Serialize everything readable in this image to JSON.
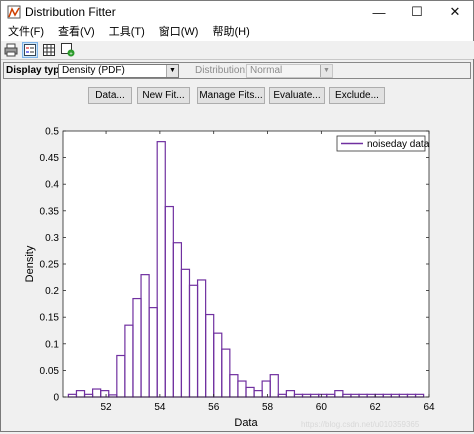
{
  "window": {
    "title": "Distribution Fitter",
    "min_icon": "minimize-icon",
    "max_icon": "maximize-icon",
    "close_icon": "close-icon"
  },
  "menu": [
    "文件(F)",
    "查看(V)",
    "工具(T)",
    "窗口(W)",
    "帮助(H)"
  ],
  "toolbar": {
    "icons": [
      "print-icon",
      "legend-icon",
      "grid-icon",
      "confidence-bounds-icon"
    ]
  },
  "options": {
    "display_type_label": "Display type:",
    "display_type_value": "Density (PDF)",
    "distribution_label": "Distribution:",
    "distribution_value": "Normal"
  },
  "buttons": {
    "data": "Data...",
    "new_fit": "New Fit...",
    "manage_fits": "Manage Fits...",
    "evaluate": "Evaluate...",
    "exclude": "Exclude..."
  },
  "watermark": "https://blog.csdn.net/u010359365",
  "chart_data": {
    "type": "bar",
    "xlabel": "Data",
    "ylabel": "Density",
    "xlim": [
      50.4,
      64.0
    ],
    "ylim": [
      0,
      0.5
    ],
    "xticks": [
      52,
      54,
      56,
      58,
      60,
      62,
      64
    ],
    "yticks": [
      0,
      0.05,
      0.1,
      0.15,
      0.2,
      0.25,
      0.3,
      0.35,
      0.4,
      0.45,
      0.5
    ],
    "bin_edges": [
      50.6,
      50.9,
      51.2,
      51.5,
      51.8,
      52.1,
      52.4,
      52.7,
      53.0,
      53.3,
      53.6,
      53.9,
      54.2,
      54.5,
      54.8,
      55.1,
      55.4,
      55.7,
      56.0,
      56.3,
      56.6,
      56.9,
      57.2,
      57.5,
      57.8,
      58.1,
      58.4,
      58.7,
      59.0,
      59.3,
      59.6,
      59.9,
      60.2,
      60.5,
      60.8,
      61.1,
      61.4,
      61.7,
      62.0,
      62.3,
      62.6,
      62.9,
      63.2,
      63.5,
      63.8
    ],
    "series": [
      {
        "name": "noiseday data",
        "values": [
          0.005,
          0.012,
          0.005,
          0.015,
          0.012,
          0.004,
          0.078,
          0.135,
          0.185,
          0.23,
          0.168,
          0.48,
          0.358,
          0.29,
          0.24,
          0.21,
          0.22,
          0.155,
          0.12,
          0.09,
          0.042,
          0.03,
          0.018,
          0.012,
          0.03,
          0.042,
          0.005,
          0.012,
          0.005,
          0.005,
          0.005,
          0.005,
          0.005,
          0.012,
          0.005,
          0.005,
          0.005,
          0.005,
          0.005,
          0.005,
          0.005,
          0.005,
          0.005,
          0.005
        ]
      }
    ],
    "color": "#7030a0",
    "legend_position": "top-right"
  }
}
